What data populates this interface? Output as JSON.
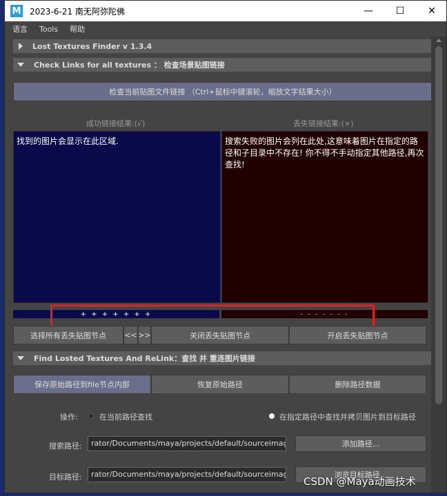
{
  "window": {
    "title": "2023-6-21   南无阿弥陀佛",
    "app_icon": "M"
  },
  "titlebar_buttons": {
    "minimize": "—",
    "maximize": "☐",
    "close": "✕"
  },
  "menu": [
    "语言",
    "Tools",
    "帮助"
  ],
  "sections": {
    "finder": "Lost Textures Finder  v 1.3.4",
    "check": "Check Links for all textures ： 检查场景贴图链接",
    "relink": "Find Losted Textures  And  ReLink：查找 并 重连图片链接"
  },
  "check_button": "检查当前贴图文件链接  （Ctrl+鼠标中键滚轮，缩放文字结果大小）",
  "success_label": "成功链接结果:(√)",
  "fail_label": "丢失链接结果:(×)",
  "success_text": "找到的图片会显示在此区域.",
  "fail_text": "搜索失败的图片会列在此处,这意味着图片在指定的路径和子目录中不存在! 你不得不手动指定其他路径,再次查找!",
  "plus_bar": "+ + + + + + +",
  "minus_bar": "- - - - - - -",
  "row1": {
    "select_lost": "选择所有丢失贴图节点",
    "prev": "<<",
    "next": ">>",
    "close_lost": "关闭丢失贴图节点",
    "open_lost": "开启丢失贴图节点"
  },
  "row2": {
    "save_original": "保存原始路径到file节点内部",
    "restore": "恢复原始路径",
    "delete_data": "删除路径数据"
  },
  "operation": {
    "label": "操作:",
    "option1": "在当前路径查找",
    "option2": "在指定路径中查找并拷贝图片到目标路径"
  },
  "search_path": {
    "label": "搜索路径:",
    "value": "rator/Documents/maya/projects/default/sourceimages/",
    "button": "添加路径..."
  },
  "target_path": {
    "label": "目标路径:",
    "value": "rator/Documents/maya/projects/default/sourceimages/",
    "button": "浏览目标路径..."
  },
  "watermark": "CSDN @Maya动画技术",
  "colors": {
    "success_bg": "#0a0a4a",
    "fail_bg": "#200000",
    "highlight": "#e02020"
  }
}
